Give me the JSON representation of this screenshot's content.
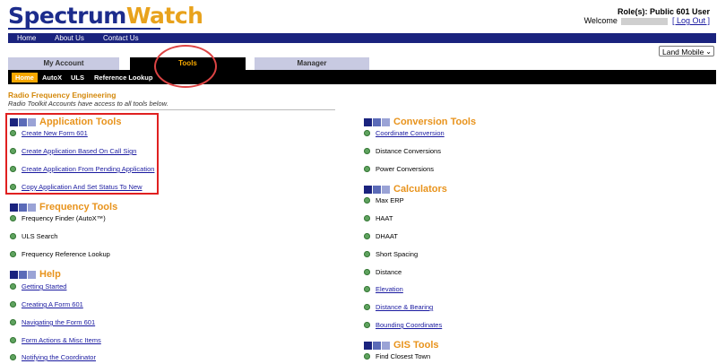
{
  "header": {
    "logo_part1": "Spectrum",
    "logo_part2": "Watch",
    "role_text": "Role(s): Public 601 User",
    "welcome_text": "Welcome",
    "logout_label": "[ Log Out ]"
  },
  "topnav": [
    "Home",
    "About Us",
    "Contact Us"
  ],
  "dropdown": {
    "selected": "Land Mobile"
  },
  "tabs": {
    "my_account": "My Account",
    "tools": "Tools",
    "manager": "Manager"
  },
  "subnav": [
    "Home",
    "AutoX",
    "ULS",
    "Reference Lookup"
  ],
  "section": {
    "title": "Radio Frequency Engineering",
    "subtitle": "Radio Toolkit Accounts have access to all tools below."
  },
  "left": {
    "application_tools": {
      "title": "Application Tools",
      "items": [
        "Create New Form 601",
        "Create Application Based On Call Sign",
        "Create Application From Pending Application",
        "Copy Application And Set Status To New"
      ]
    },
    "frequency_tools": {
      "title": "Frequency Tools",
      "items": [
        "Frequency Finder (AutoX™)",
        "ULS Search",
        "Frequency Reference Lookup"
      ]
    },
    "help": {
      "title": "Help",
      "items": [
        "Getting Started",
        "Creating A Form 601",
        "Navigating the Form 601",
        "Form Actions & Misc Items",
        "Notifying the Coordinator"
      ]
    }
  },
  "right": {
    "conversion_tools": {
      "title": "Conversion Tools",
      "items": [
        "Coordinate Conversion",
        "Distance Conversions",
        "Power Conversions"
      ]
    },
    "calculators": {
      "title": "Calculators",
      "items": [
        "Max ERP",
        "HAAT",
        "DHAAT",
        "Short Spacing",
        "Distance",
        "Elevation",
        "Distance & Bearing",
        "Bounding Coordinates"
      ]
    },
    "gis_tools": {
      "title": "GIS Tools",
      "items": [
        "Find Closest Town"
      ]
    }
  },
  "colors": {
    "nav": "#1a237e",
    "accent": "#f7a800",
    "link": "#1a1aa0",
    "annotation": "#e02020"
  }
}
